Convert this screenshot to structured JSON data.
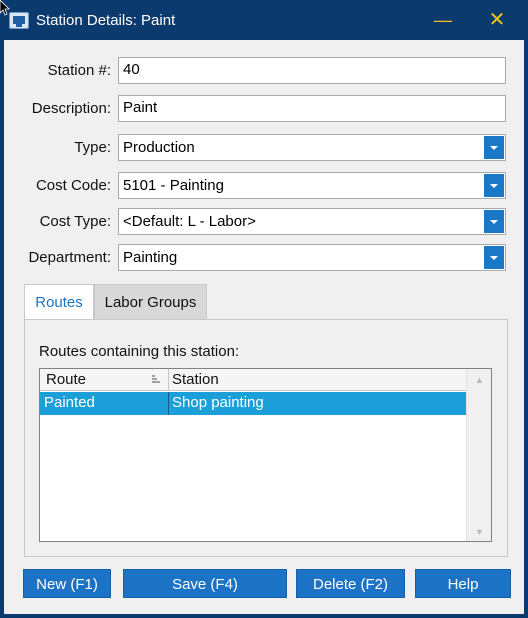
{
  "window": {
    "title": "Station Details:  Paint",
    "minimize_glyph": "—",
    "close_glyph": "✕"
  },
  "form": {
    "station_label": "Station #:",
    "station_value": "40",
    "description_label": "Description:",
    "description_value": "Paint",
    "type_label": "Type:",
    "type_value": "Production",
    "cost_code_label": "Cost Code:",
    "cost_code_value": "5101 - Painting",
    "cost_type_label": "Cost Type:",
    "cost_type_value": "<Default: L - Labor>",
    "department_label": "Department:",
    "department_value": "Painting"
  },
  "tabs": [
    {
      "label": "Routes",
      "active": true
    },
    {
      "label": "Labor Groups",
      "active": false
    }
  ],
  "routes_panel": {
    "caption": "Routes containing this station:",
    "columns": [
      "Route",
      "Station"
    ],
    "rows": [
      {
        "route": "Painted",
        "station": "Shop painting",
        "selected": true
      }
    ]
  },
  "buttons": {
    "new": "New (F1)",
    "save": "Save (F4)",
    "delete": "Delete (F2)",
    "help": "Help"
  },
  "colors": {
    "title_bar": "#0b3a6e",
    "accent": "#1c72c4",
    "selection": "#1c9fd8",
    "window_controls": "#f0c419"
  },
  "icons": {
    "app": "station-details-icon",
    "dropdown": "chevron-down-icon",
    "sort": "sort-icon"
  }
}
